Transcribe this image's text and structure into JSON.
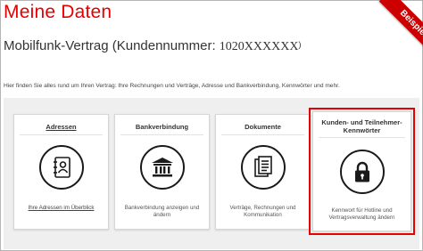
{
  "page": {
    "title": "Meine Daten",
    "contract_prefix": "Mobilfunk-Vertrag (Kundennummer: ",
    "customer_number": "1020XXXXXX",
    "contract_suffix": ")",
    "intro": "Hier finden Sie alles rund um Ihren Vertrag: Ihre Rechnungen und Verträge, Adresse und Bankverbindung, Kennwörter und mehr.",
    "ribbon": "Beispiel"
  },
  "cards": [
    {
      "title": "Adressen",
      "description": "Ihre Adressen im Überblick",
      "icon": "address-book-icon"
    },
    {
      "title": "Bankverbindung",
      "description": "Bankverbindung anzeigen und ändern",
      "icon": "bank-icon"
    },
    {
      "title": "Dokumente",
      "description": "Verträge, Rechnungen und Kommunikation",
      "icon": "documents-icon"
    },
    {
      "title": "Kunden- und Teilnehmer-Kennwörter",
      "description": "Kennwort für Hotline und Vertragsverwaltung ändern",
      "icon": "padlock-icon"
    }
  ],
  "colors": {
    "brand_red": "#e60000",
    "ribbon_red": "#cc0000",
    "panel_gray": "#efefef"
  }
}
